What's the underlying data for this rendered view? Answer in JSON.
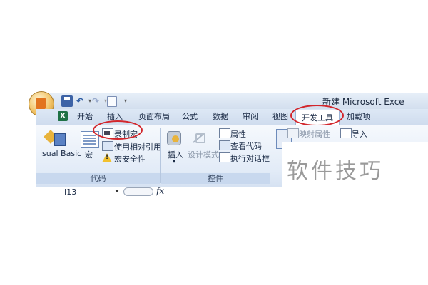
{
  "window": {
    "title": "新建 Microsoft Exce"
  },
  "quick_access": {
    "save_icon": "save-icon",
    "undo_icon": "undo-icon",
    "redo_icon": "redo-icon",
    "print_preview_icon": "print-preview-icon"
  },
  "tabs": {
    "home": "开始",
    "insert": "插入",
    "page_layout": "页面布局",
    "formulas": "公式",
    "data": "数据",
    "review": "审阅",
    "view": "视图",
    "developer": "开发工具",
    "addins": "加载项"
  },
  "ribbon": {
    "code_group": {
      "label": "代码",
      "visual_basic": "isual Basic",
      "macros": "宏",
      "record_macro": "录制宏",
      "use_relative": "使用相对引用",
      "macro_security": "宏安全性"
    },
    "controls_group": {
      "label": "控件",
      "insert": "插入",
      "design_mode": "设计模式",
      "properties": "属性",
      "view_code": "查看代码",
      "run_dialog": "执行对话框"
    },
    "xml_group": {
      "map_properties": "映射属性",
      "import": "导入"
    }
  },
  "formula_bar": {
    "name_box": "I13",
    "fx_label": "fx"
  },
  "watermark": "软件技巧",
  "colors": {
    "highlight_oval": "#d2262c",
    "ribbon_bg": "#e2ebf7"
  }
}
